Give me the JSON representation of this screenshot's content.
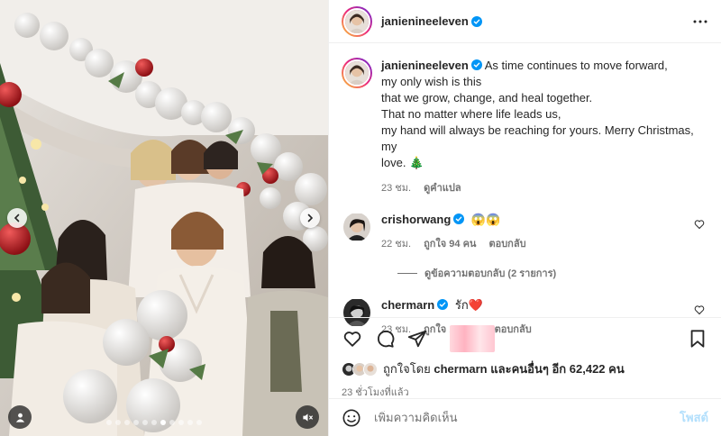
{
  "post": {
    "author": "janienineeleven",
    "caption_lines": [
      "As time continues to move forward,",
      "my only wish is this",
      "that we grow, change, and heal together.",
      "That no matter where life leads us,",
      "my hand will always be reaching for yours. Merry Christmas, my",
      "love. 🎄"
    ],
    "caption_time": "23 ชม.",
    "see_translation": "ดูคำแปล"
  },
  "comments": [
    {
      "username": "crishorwang",
      "text": "😱😱",
      "time": "22 ชม.",
      "likes": "ถูกใจ 94 คน",
      "reply": "ตอบกลับ",
      "view_replies": "ดูข้อความตอบกลับ (2 รายการ)"
    },
    {
      "username": "chermarn",
      "text": "รัก❤️",
      "time": "23 ชม.",
      "likes": "ถูกใจ 101 คน",
      "reply": "ตอบกลับ"
    }
  ],
  "likes_line": {
    "prefix": "ถูกใจโดย",
    "user": "chermarn",
    "middle": "และคนอื่นๆ อีก",
    "count": "62,422 คน"
  },
  "posted_ago": "23 ชั่วโมงที่แล้ว",
  "add_comment": {
    "placeholder": "เพิ่มความคิดเห็น",
    "post_label": "โพสต์"
  },
  "carousel": {
    "slide_count": 11,
    "active_index": 6
  },
  "colors": {
    "verified": "#0095f6",
    "link_disabled": "#b2dffc",
    "secondary_text": "#737373"
  },
  "icons": {
    "heart": "heart-icon",
    "comment": "comment-icon",
    "share": "share-icon",
    "save": "bookmark-icon",
    "more": "more-icon",
    "emoji": "emoji-icon"
  }
}
